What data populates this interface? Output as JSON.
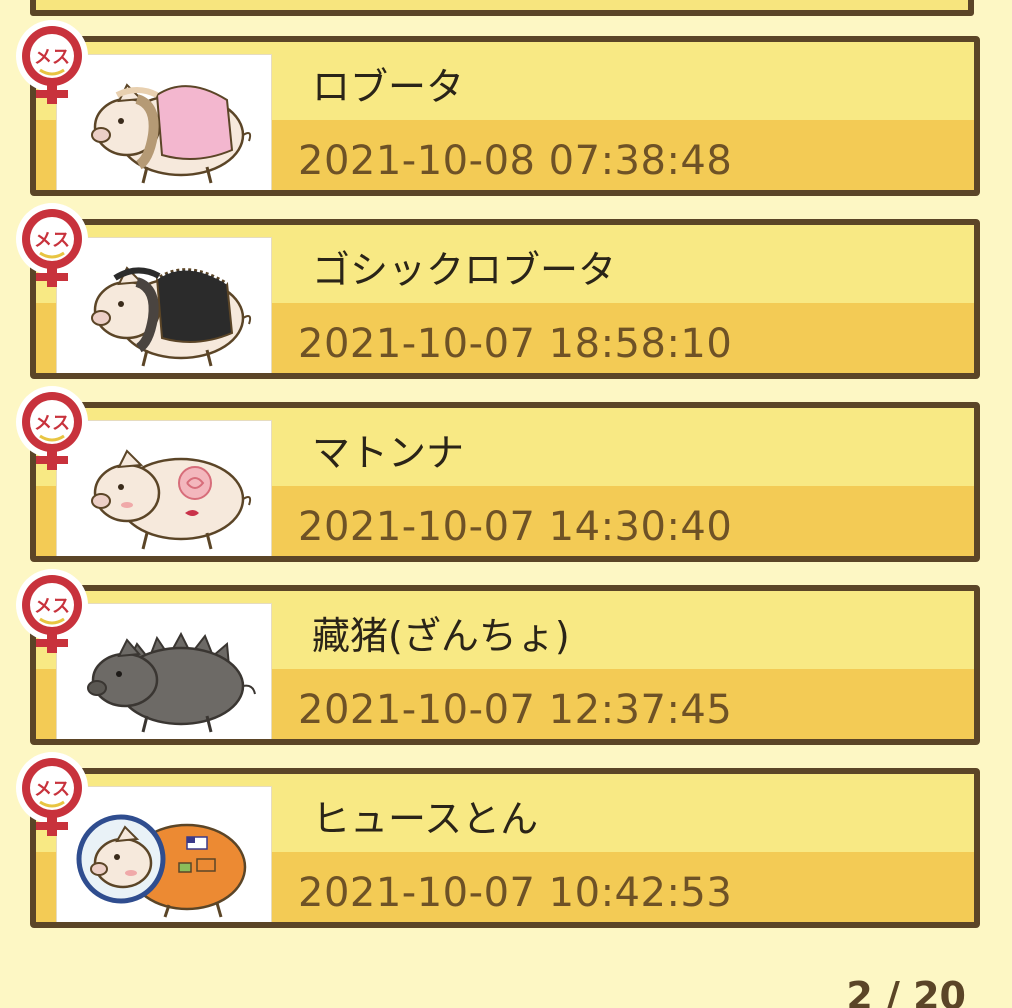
{
  "list": {
    "items": [
      {
        "name": "ロブータ",
        "timestamp": "2021-10-08 07:38:48",
        "badge_label": "メス",
        "pig_icon": "lolita-pig-icon",
        "body_color": "#f6e9dc",
        "outfit_color": "#f3b7cf"
      },
      {
        "name": "ゴシックロブータ",
        "timestamp": "2021-10-07 18:58:10",
        "badge_label": "メス",
        "pig_icon": "gothic-lolita-pig-icon",
        "body_color": "#f6e9dc",
        "outfit_color": "#2b2b2b"
      },
      {
        "name": "マトンナ",
        "timestamp": "2021-10-07 14:30:40",
        "badge_label": "メス",
        "pig_icon": "rose-tattoo-pig-icon",
        "body_color": "#f6e9dc",
        "outfit_color": "#e48a92"
      },
      {
        "name": "藏猪(ざんちょ)",
        "timestamp": "2021-10-07 12:37:45",
        "badge_label": "メス",
        "pig_icon": "tibetan-boar-icon",
        "body_color": "#6d6a66",
        "outfit_color": "#6d6a66"
      },
      {
        "name": "ヒュースとん",
        "timestamp": "2021-10-07 10:42:53",
        "badge_label": "メス",
        "pig_icon": "astronaut-pig-icon",
        "body_color": "#f6e9dc",
        "outfit_color": "#ec8a33"
      }
    ]
  },
  "pager": {
    "text": "2 / 20"
  },
  "colors": {
    "card_top": "#f8e984",
    "card_bottom": "#f3cb55",
    "border": "#5b4527",
    "background": "#fdf7c4",
    "badge_red": "#c8323c"
  }
}
